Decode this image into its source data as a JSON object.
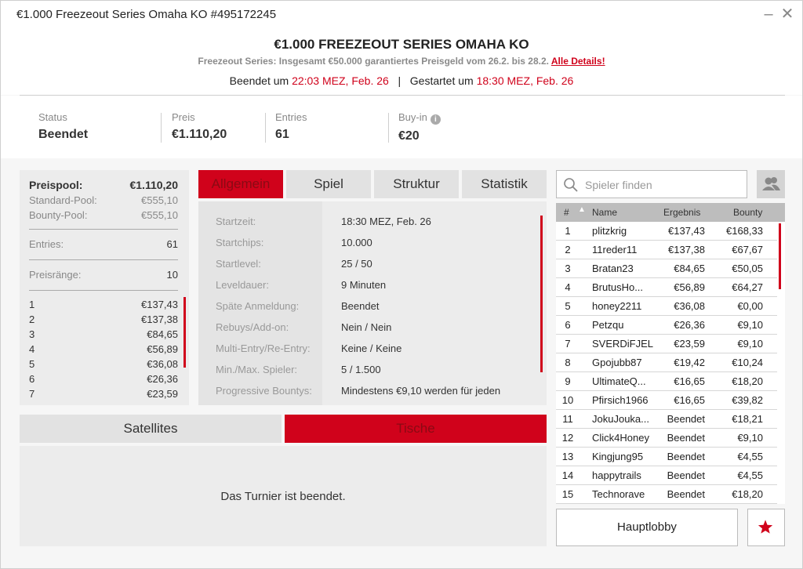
{
  "window": {
    "title": "€1.000 Freezeout Series Omaha KO #495172245",
    "minimize_icon": "minimize-icon",
    "close_icon": "close-icon"
  },
  "header": {
    "title": "€1.000 FREEZEOUT SERIES OMAHA KO",
    "subtitle": "Freezeout Series: Insgesamt €50.000 garantiertes Preisgeld vom 26.2. bis 28.2.",
    "details_link": "Alle Details!",
    "ended_label": "Beendet um",
    "ended_value": "22:03 MEZ, Feb. 26",
    "separator": "|",
    "started_label": "Gestartet um",
    "started_value": "18:30 MEZ, Feb. 26"
  },
  "summary": {
    "status_label": "Status",
    "status_value": "Beendet",
    "prize_label": "Preis",
    "prize_value": "€1.110,20",
    "entries_label": "Entries",
    "entries_value": "61",
    "buyin_label": "Buy-in",
    "buyin_value": "€20",
    "info_icon": "i"
  },
  "prize_panel": {
    "pool_label": "Preispool:",
    "pool_value": "€1.110,20",
    "standard_label": "Standard-Pool:",
    "standard_value": "€555,10",
    "bounty_label": "Bounty-Pool:",
    "bounty_value": "€555,10",
    "entries_label": "Entries:",
    "entries_value": "61",
    "ranks_label": "Preisränge:",
    "ranks_value": "10",
    "places": [
      {
        "place": "1",
        "amount": "€137,43"
      },
      {
        "place": "2",
        "amount": "€137,38"
      },
      {
        "place": "3",
        "amount": "€84,65"
      },
      {
        "place": "4",
        "amount": "€56,89"
      },
      {
        "place": "5",
        "amount": "€36,08"
      },
      {
        "place": "6",
        "amount": "€26,36"
      },
      {
        "place": "7",
        "amount": "€23,59"
      }
    ]
  },
  "tabs": [
    "Allgemein",
    "Spiel",
    "Struktur",
    "Statistik"
  ],
  "details": [
    {
      "key": "Startzeit:",
      "value": "18:30 MEZ, Feb. 26"
    },
    {
      "key": "Startchips:",
      "value": "10.000"
    },
    {
      "key": "Startlevel:",
      "value": "25 / 50"
    },
    {
      "key": "Leveldauer:",
      "value": "9 Minuten"
    },
    {
      "key": "Späte Anmeldung:",
      "value": "Beendet"
    },
    {
      "key": "Rebuys/Add-on:",
      "value": "Nein / Nein"
    },
    {
      "key": "Multi-Entry/Re-Entry:",
      "value": "Keine / Keine"
    },
    {
      "key": "Min./Max. Spieler:",
      "value": "5 / 1.500"
    },
    {
      "key": "Progressive Bountys:",
      "value": "Mindestens €9,10 werden für jeden"
    }
  ],
  "lower_tabs": [
    "Satellites",
    "Tische"
  ],
  "lower_message": "Das Turnier ist beendet.",
  "search": {
    "placeholder": "Spieler finden"
  },
  "players_header": {
    "num": "#",
    "name": "Name",
    "result": "Ergebnis",
    "bounty": "Bounty"
  },
  "players": [
    {
      "rank": "1",
      "name": "plitzkrig",
      "result": "€137,43",
      "bounty": "€168,33"
    },
    {
      "rank": "2",
      "name": "11reder11",
      "result": "€137,38",
      "bounty": "€67,67"
    },
    {
      "rank": "3",
      "name": "Bratan23",
      "result": "€84,65",
      "bounty": "€50,05"
    },
    {
      "rank": "4",
      "name": "BrutusHo...",
      "result": "€56,89",
      "bounty": "€64,27"
    },
    {
      "rank": "5",
      "name": "honey2211",
      "result": "€36,08",
      "bounty": "€0,00"
    },
    {
      "rank": "6",
      "name": "Petzqu",
      "result": "€26,36",
      "bounty": "€9,10"
    },
    {
      "rank": "7",
      "name": "SVERDiFJELL",
      "result": "€23,59",
      "bounty": "€9,10"
    },
    {
      "rank": "8",
      "name": "Gpojubb87",
      "result": "€19,42",
      "bounty": "€10,24"
    },
    {
      "rank": "9",
      "name": "UltimateQ...",
      "result": "€16,65",
      "bounty": "€18,20"
    },
    {
      "rank": "10",
      "name": "Pfirsich1966",
      "result": "€16,65",
      "bounty": "€39,82"
    },
    {
      "rank": "11",
      "name": "JokuJouka...",
      "result": "Beendet",
      "bounty": "€18,21"
    },
    {
      "rank": "12",
      "name": "Click4Honey",
      "result": "Beendet",
      "bounty": "€9,10"
    },
    {
      "rank": "13",
      "name": "Kingjung95",
      "result": "Beendet",
      "bounty": "€4,55"
    },
    {
      "rank": "14",
      "name": "happytrails",
      "result": "Beendet",
      "bounty": "€4,55"
    },
    {
      "rank": "15",
      "name": "Technorave",
      "result": "Beendet",
      "bounty": "€18,20"
    }
  ],
  "lobby_button": "Hauptlobby",
  "colors": {
    "accent": "#d0021b",
    "panel": "#ececec",
    "tab": "#e2e2e2"
  }
}
